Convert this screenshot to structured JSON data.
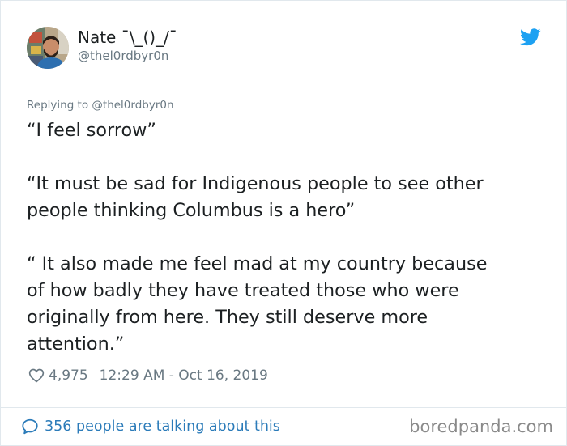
{
  "tweet": {
    "author": {
      "display_name": "Nate ¯\\_()_/¯",
      "handle": "@thel0rdbyr0n"
    },
    "reply_context": "Replying to @thel0rdbyr0n",
    "paragraphs": [
      [
        "“I feel sorrow”"
      ],
      [
        "“It must be sad for Indigenous people to see other",
        "people thinking Columbus is a hero”"
      ],
      [
        "“ It also made me feel mad at my country because",
        "of how badly they have treated those who were",
        "originally from here. They still deserve more",
        "attention.”"
      ]
    ],
    "likes": "4,975",
    "timestamp": "12:29 AM - Oct 16, 2019",
    "talking_about": "356 people are talking about this"
  },
  "watermark": "boredpanda.com",
  "colors": {
    "text": "#1c2022",
    "secondary": "#697882",
    "link": "#2b7bb9",
    "twitter_blue": "#1da1f2",
    "border": "#e1e8ed"
  },
  "icons": [
    "avatar",
    "twitter-bird-icon",
    "heart-icon",
    "speech-bubble-icon"
  ]
}
